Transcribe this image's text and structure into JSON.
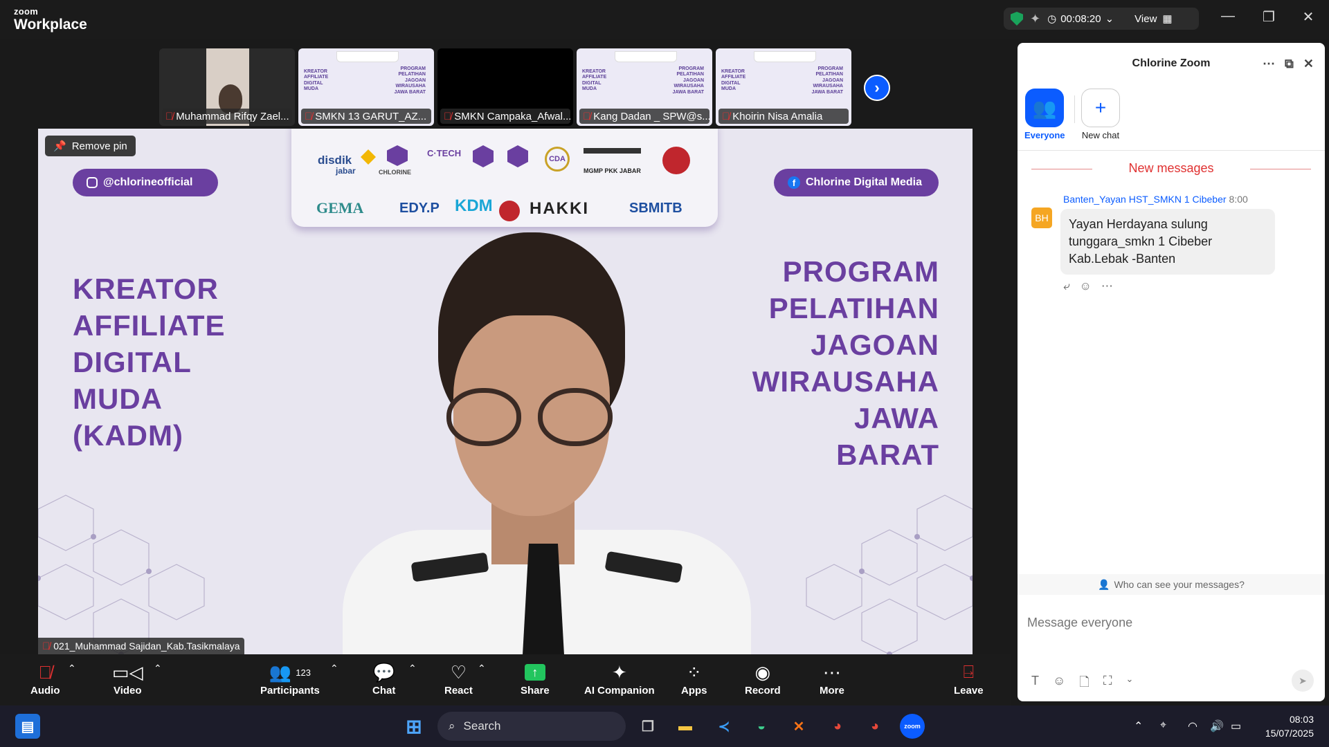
{
  "app": {
    "brand_small": "zoom",
    "brand_big": "Workplace"
  },
  "header": {
    "timer": "00:08:20",
    "view_label": "View"
  },
  "thumbnails": [
    {
      "name": "Muhammad Rifqy Zael..."
    },
    {
      "name": "SMKN 13 GARUT_AZ..."
    },
    {
      "name": "SMKN Campaka_Afwal..."
    },
    {
      "name": "Kang Dadan _ SPW@s..."
    },
    {
      "name": "Khoirin Nisa Amalia"
    }
  ],
  "main": {
    "remove_pin": "Remove pin",
    "instagram": "@chlorineofficial",
    "facebook": "Chlorine Digital Media",
    "left_title": [
      "KREATOR",
      "AFFILIATE",
      "DIGITAL",
      "MUDA",
      "(KADM)"
    ],
    "right_title": [
      "PROGRAM",
      "PELATIHAN",
      "JAGOAN",
      "WIRAUSAHA",
      "JAWA",
      "BARAT"
    ],
    "logos": {
      "disdik": "disdik",
      "jabar": "jabar",
      "chlorine": "CHLORINE",
      "ctech": "C·TECH",
      "cda": "CDA",
      "gema": "GEMA",
      "edyp": "EDY.P",
      "kdm": "KDM",
      "hakki": "HAKKI",
      "sbmitb": "SBMITB",
      "mgmp": "MGMP PKK JABAR"
    },
    "speaker_name": "021_Muhammad Sajidan_Kab.Tasikmalaya"
  },
  "toolbar": {
    "audio": "Audio",
    "video": "Video",
    "participants": "Participants",
    "participants_count": "123",
    "chat": "Chat",
    "react": "React",
    "share": "Share",
    "ai": "AI Companion",
    "apps": "Apps",
    "record": "Record",
    "more": "More",
    "leave": "Leave"
  },
  "chat": {
    "title": "Chlorine Zoom",
    "everyone": "Everyone",
    "new_chat": "New chat",
    "new_messages": "New messages",
    "message": {
      "avatar": "BH",
      "sender": "Banten_Yayan HST_SMKN 1 Cibeber",
      "time": "8:00",
      "text": "Yayan Herdayana sulung tunggara_smkn 1 Cibeber Kab.Lebak -Banten"
    },
    "who_can_see": "Who can see your messages?",
    "placeholder": "Message everyone"
  },
  "taskbar": {
    "search": "Search",
    "time": "08:03",
    "date": "15/07/2025"
  },
  "colors": {
    "accent": "#0b5cff",
    "purple": "#6a3fa0",
    "danger": "#e03131",
    "share": "#22c55e"
  }
}
